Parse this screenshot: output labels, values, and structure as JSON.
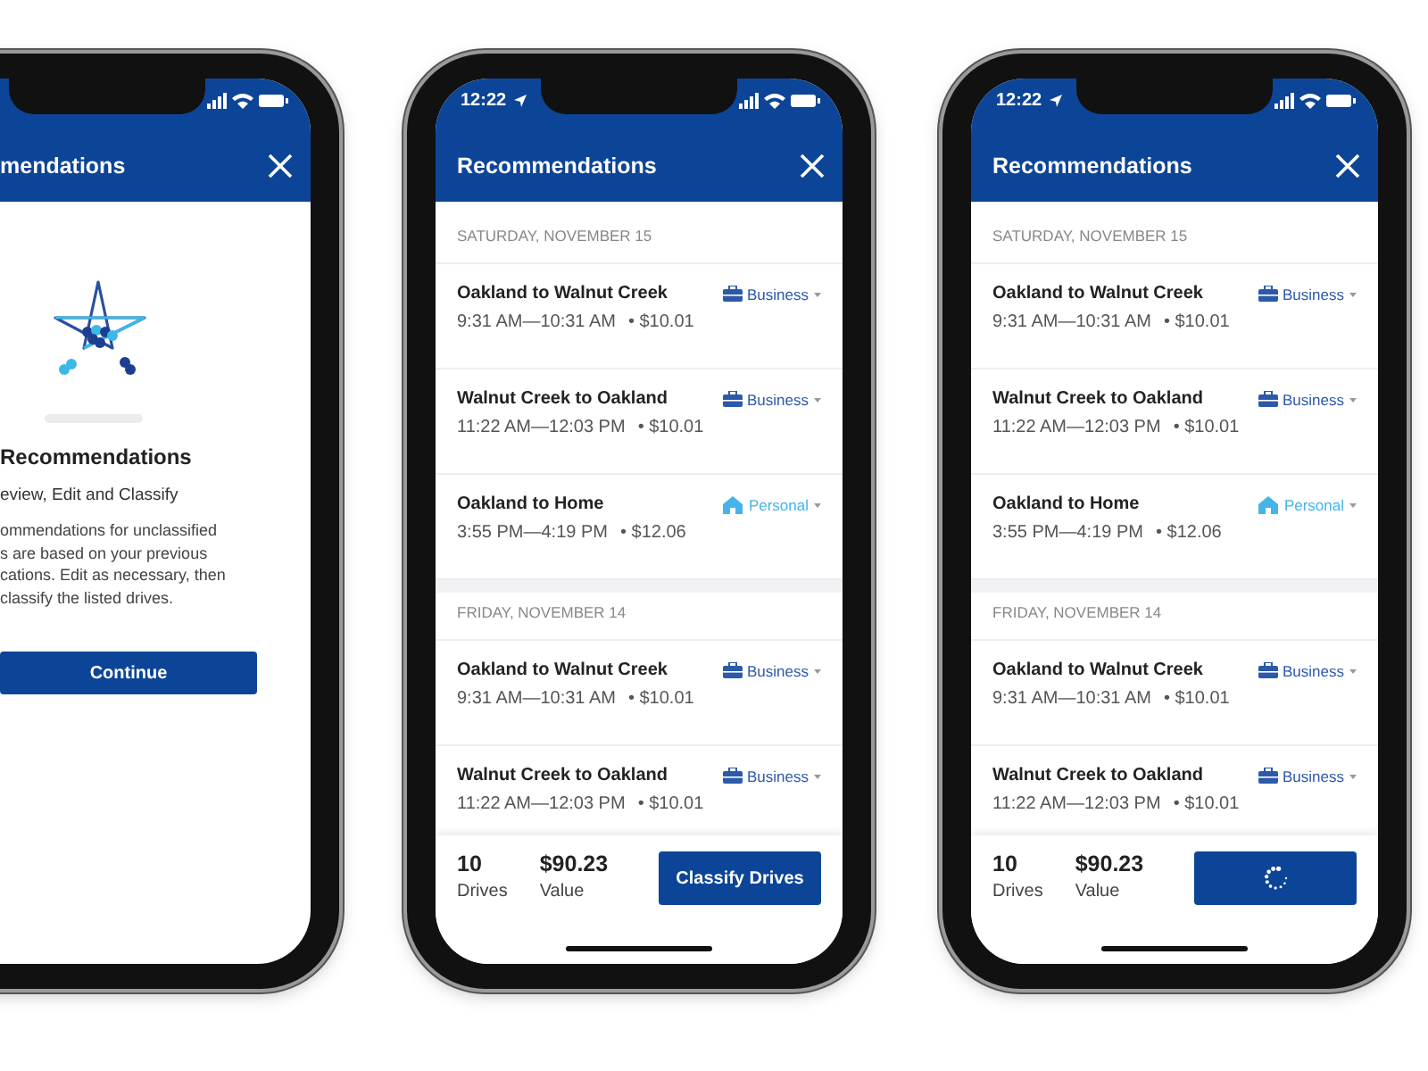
{
  "phones": [
    {
      "kind": "intro",
      "header": {
        "title": "mendations"
      },
      "heading": "Recommendations",
      "subheading": "eview, Edit and Classify",
      "description_lines": [
        "ommendations for unclassified",
        "s are based on your previous",
        "cations. Edit as necessary, then",
        "classify the listed drives."
      ],
      "button": {
        "label": "Continue"
      }
    },
    {
      "kind": "list",
      "status": {
        "time": "12:22"
      },
      "header": {
        "title": "Recommendations"
      },
      "sections": [
        {
          "date": "SATURDAY, NOVEMBER 15",
          "drives": [
            {
              "route": "Oakland to Walnut Creek",
              "times": "9:31 AM—10:31 AM",
              "amount": "• $10.01",
              "category": "Business",
              "kind": "business"
            },
            {
              "route": "Walnut Creek to Oakland",
              "times": "11:22 AM—12:03 PM",
              "amount": "• $10.01",
              "category": "Business",
              "kind": "business"
            },
            {
              "route": "Oakland to Home",
              "times": "3:55 PM—4:19 PM",
              "amount": "• $12.06",
              "category": "Personal",
              "kind": "personal"
            }
          ]
        },
        {
          "date": "FRIDAY, NOVEMBER 14",
          "drives": [
            {
              "route": "Oakland to Walnut Creek",
              "times": "9:31 AM—10:31 AM",
              "amount": "• $10.01",
              "category": "Business",
              "kind": "business"
            },
            {
              "route": "Walnut Creek to Oakland",
              "times": "11:22 AM—12:03 PM",
              "amount": "• $10.01",
              "category": "Business",
              "kind": "business"
            }
          ]
        }
      ],
      "summary": {
        "drives_count": "10",
        "drives_label": "Drives",
        "value": "$90.23",
        "value_label": "Value"
      },
      "button": {
        "label": "Classify Drives",
        "loading": false
      }
    },
    {
      "kind": "list",
      "status": {
        "time": "12:22"
      },
      "header": {
        "title": "Recommendations"
      },
      "sections": [
        {
          "date": "SATURDAY, NOVEMBER 15",
          "drives": [
            {
              "route": "Oakland to Walnut Creek",
              "times": "9:31 AM—10:31 AM",
              "amount": "• $10.01",
              "category": "Business",
              "kind": "business"
            },
            {
              "route": "Walnut Creek to Oakland",
              "times": "11:22 AM—12:03 PM",
              "amount": "• $10.01",
              "category": "Business",
              "kind": "business"
            },
            {
              "route": "Oakland to Home",
              "times": "3:55 PM—4:19 PM",
              "amount": "• $12.06",
              "category": "Personal",
              "kind": "personal"
            }
          ]
        },
        {
          "date": "FRIDAY, NOVEMBER 14",
          "drives": [
            {
              "route": "Oakland to Walnut Creek",
              "times": "9:31 AM—10:31 AM",
              "amount": "• $10.01",
              "category": "Business",
              "kind": "business"
            },
            {
              "route": "Walnut Creek to Oakland",
              "times": "11:22 AM—12:03 PM",
              "amount": "• $10.01",
              "category": "Business",
              "kind": "business"
            }
          ]
        }
      ],
      "summary": {
        "drives_count": "10",
        "drives_label": "Drives",
        "value": "$90.23",
        "value_label": "Value"
      },
      "button": {
        "loading": true
      }
    }
  ]
}
